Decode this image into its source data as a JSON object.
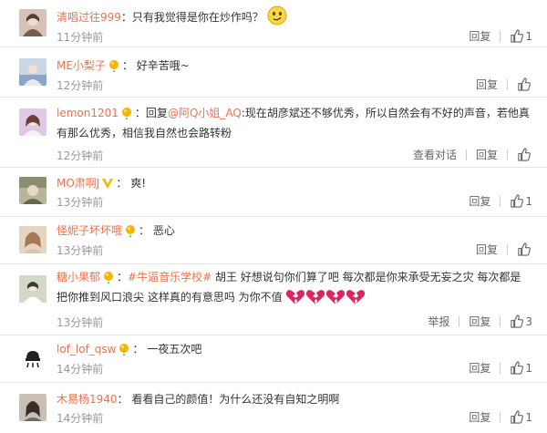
{
  "comments": [
    {
      "user": "清唱过往999",
      "badge": false,
      "text": "只有我觉得是你在炒作吗？",
      "time": "11分钟前",
      "reply_label": "回复",
      "likes": "1",
      "avatar_color": "#d7c2b8"
    },
    {
      "user": "ME小梨子",
      "badge": true,
      "text": "好辛苦哦~",
      "time": "12分钟前",
      "reply_label": "回复",
      "likes": "",
      "avatar_color": "#c9d6e6"
    },
    {
      "user": "lemon1201",
      "badge": true,
      "reply_prefix": "回复",
      "reply_to": "@阿Q小姐_AQ",
      "text": ":现在胡彦斌还不够优秀，所以自然会有不好的声音，若他真有那么优秀，相信我自然也会路转粉",
      "time": "12分钟前",
      "view_conversation_label": "查看对话",
      "reply_label": "回复",
      "likes": "",
      "avatar_color": "#e0c9e6"
    },
    {
      "user": "MO肃啊J",
      "badge": true,
      "text": "爽!",
      "time": "13分钟前",
      "reply_label": "回复",
      "likes": "1",
      "avatar_color": "#b9b59a"
    },
    {
      "user": "怪妮子坏坏哦",
      "badge": true,
      "text": "恶心",
      "time": "13分钟前",
      "reply_label": "回复",
      "likes": "",
      "avatar_color": "#e6d4c2"
    },
    {
      "user": "糖小果郁",
      "badge": true,
      "topic": "#牛逼音乐学校#",
      "text": "胡王  好想说句你们算了吧  每次都是你来承受无妄之灾  每次都是把你推到风口浪尖  这样真的有意思吗  为你不值",
      "broken_hearts": 4,
      "time": "13分钟前",
      "report_label": "举报",
      "reply_label": "回复",
      "likes": "3",
      "avatar_color": "#d3d9c9"
    },
    {
      "user": "lof_lof_qsw",
      "badge": true,
      "text": "一夜五次吧",
      "time": "14分钟前",
      "reply_label": "回复",
      "likes": "1",
      "avatar_color": "#ffffff"
    },
    {
      "user": "木易杨1940",
      "badge": false,
      "text": "看看自己的颜值！为什么还没有自知之明啊",
      "time": "14分钟前",
      "reply_label": "回复",
      "likes": "1",
      "avatar_color": "#c8bfb5"
    }
  ],
  "colors": {
    "username": "#eb7350",
    "meta": "#999999",
    "divider": "#e6e6e6",
    "heart": "#e0245e",
    "vip_gold": "#f5b400"
  }
}
